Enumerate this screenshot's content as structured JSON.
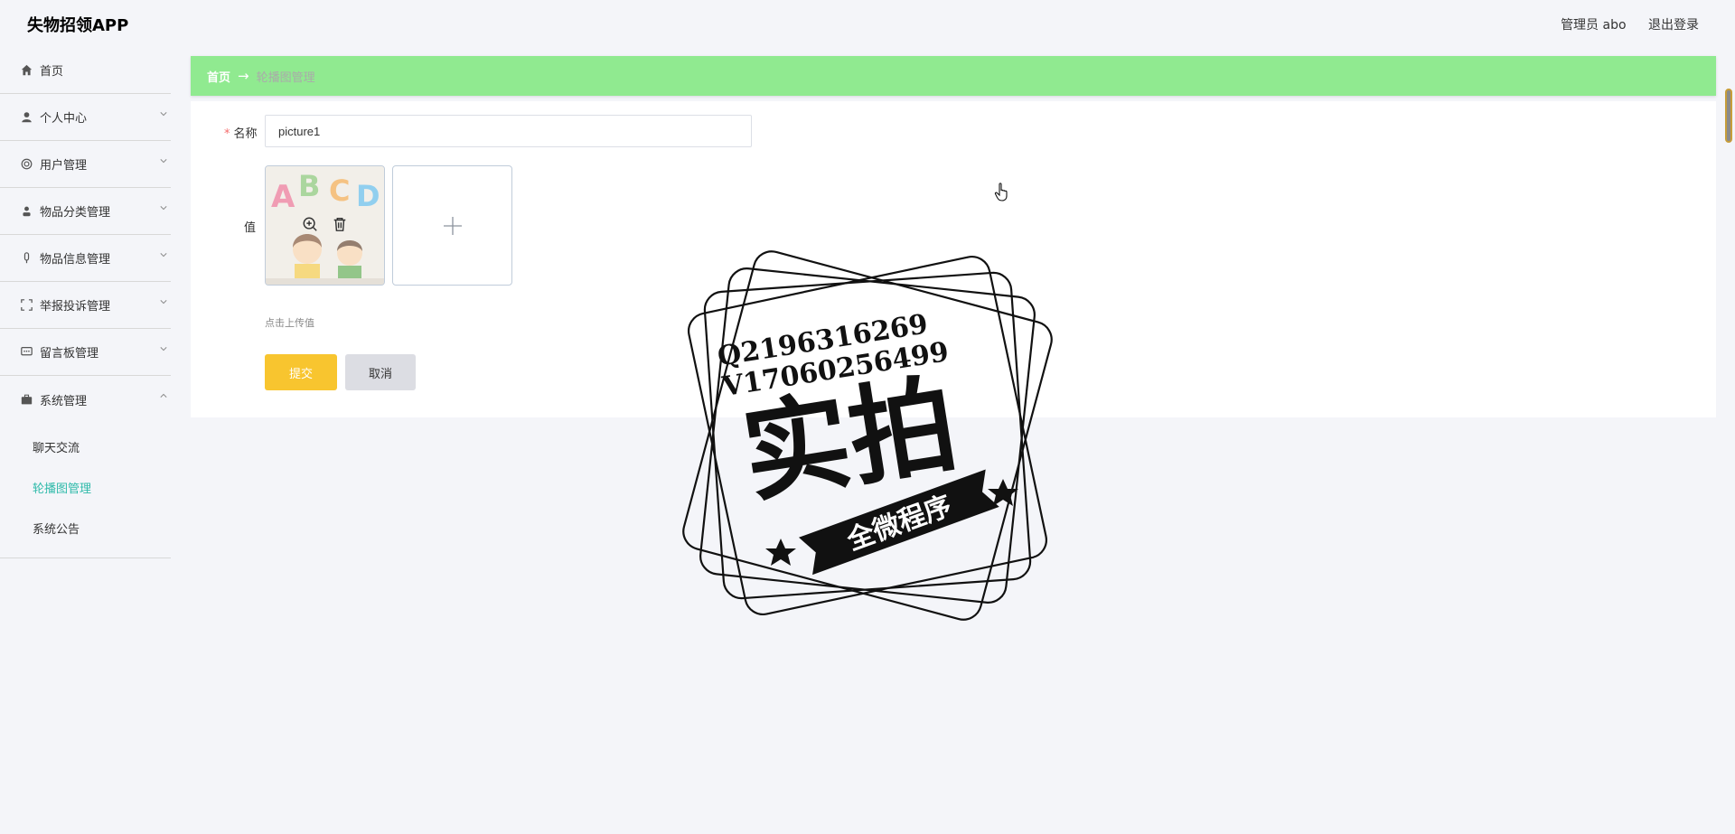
{
  "header": {
    "brand": "失物招领APP",
    "admin_label": "管理员 abo",
    "logout_label": "退出登录"
  },
  "sidebar": {
    "items": [
      {
        "label": "首页",
        "icon": "home-icon"
      },
      {
        "label": "个人中心",
        "icon": "user-icon"
      },
      {
        "label": "用户管理",
        "icon": "users-icon"
      },
      {
        "label": "物品分类管理",
        "icon": "person-icon"
      },
      {
        "label": "物品信息管理",
        "icon": "mic-icon"
      },
      {
        "label": "举报投诉管理",
        "icon": "frame-icon"
      },
      {
        "label": "留言板管理",
        "icon": "message-icon"
      },
      {
        "label": "系统管理",
        "icon": "briefcase-icon"
      }
    ],
    "sub_items": [
      {
        "label": "聊天交流"
      },
      {
        "label": "轮播图管理",
        "active": true
      },
      {
        "label": "系统公告"
      }
    ]
  },
  "breadcrumb": {
    "home": "首页",
    "separator": "→",
    "current": "轮播图管理"
  },
  "form": {
    "name_label": "名称",
    "name_required_mark": "*",
    "name_value": "picture1",
    "value_label": "值",
    "upload_hint": "点击上传值",
    "image_letters": [
      "A",
      "B",
      "C",
      "D"
    ],
    "submit_label": "提交",
    "cancel_label": "取消"
  },
  "watermark": {
    "line1": "Q2196316269",
    "line2": "V17060256499",
    "main": "实拍",
    "banner": "全微程序"
  },
  "colors": {
    "accent": "#2fbaaa",
    "breadcrumb_bg": "#90ea90",
    "submit_bg": "#f8c52f",
    "cancel_bg": "#dcdde3",
    "required": "#f56c6c"
  }
}
